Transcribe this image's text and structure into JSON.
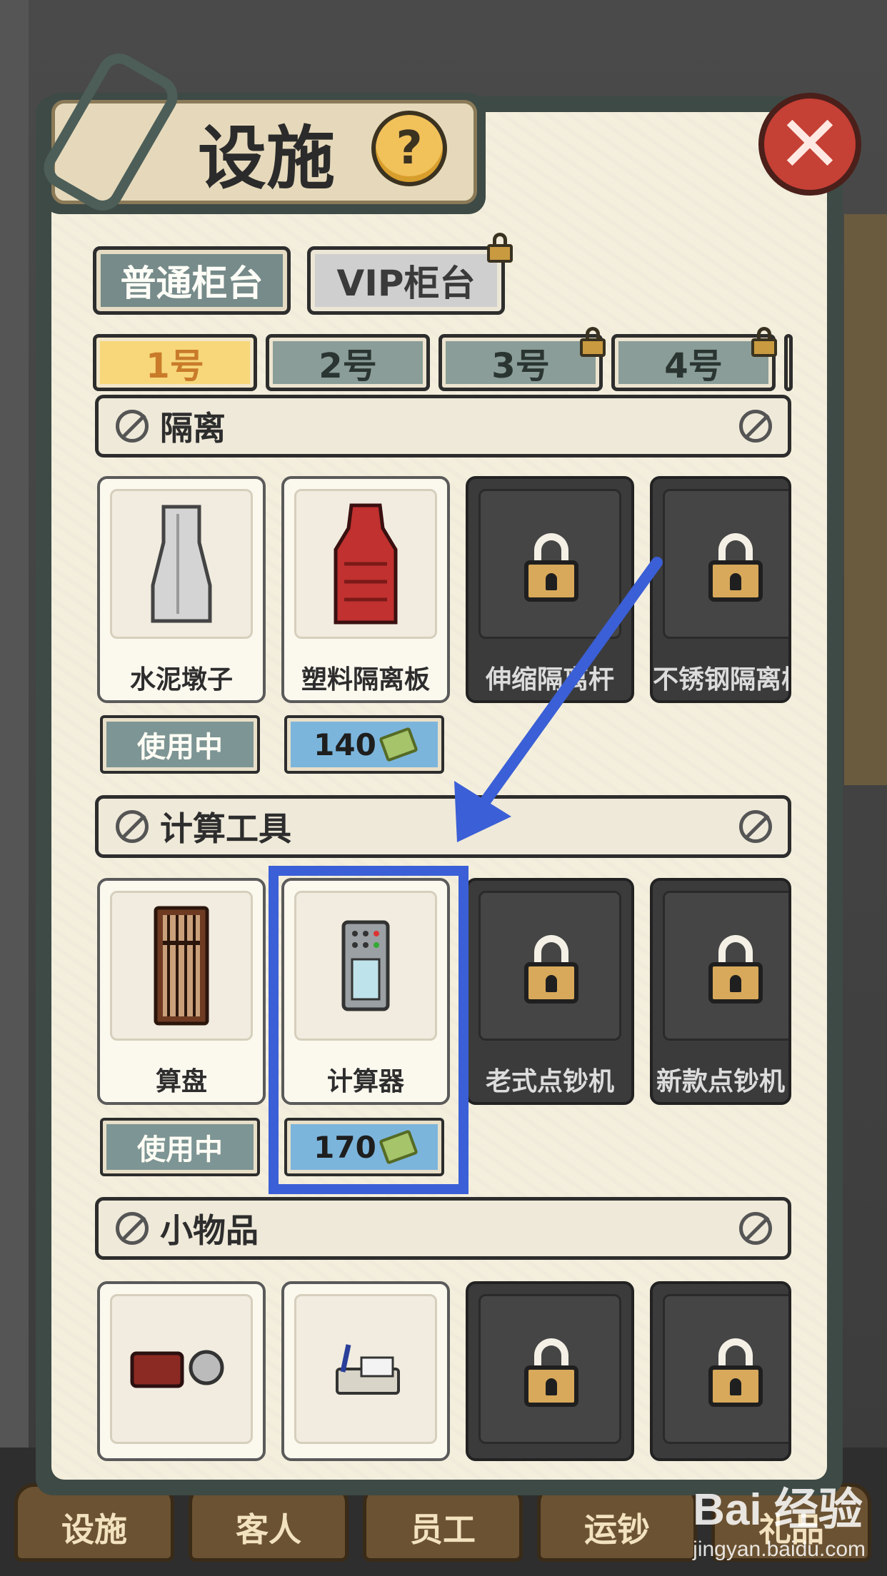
{
  "title": "设施",
  "help_label": "?",
  "close_label": "✕",
  "counter_types": [
    {
      "label": "普通柜台",
      "locked": false
    },
    {
      "label": "VIP柜台",
      "locked": true
    }
  ],
  "counter_numbers": [
    {
      "label": "1号",
      "active": true,
      "locked": false
    },
    {
      "label": "2号",
      "active": false,
      "locked": false
    },
    {
      "label": "3号",
      "active": false,
      "locked": true
    },
    {
      "label": "4号",
      "active": false,
      "locked": true
    }
  ],
  "sections": [
    {
      "title": "隔离",
      "items": [
        {
          "name": "水泥墩子",
          "locked": false,
          "status": "使用中"
        },
        {
          "name": "塑料隔离板",
          "locked": false,
          "price": "140"
        },
        {
          "name": "伸缩隔离杆",
          "locked": true
        },
        {
          "name": "不锈钢隔离栏",
          "locked": true
        }
      ]
    },
    {
      "title": "计算工具",
      "items": [
        {
          "name": "算盘",
          "locked": false,
          "status": "使用中"
        },
        {
          "name": "计算器",
          "locked": false,
          "price": "170"
        },
        {
          "name": "老式点钞机",
          "locked": true
        },
        {
          "name": "新款点钞机",
          "locked": true
        }
      ]
    },
    {
      "title": "小物品",
      "items": [
        {
          "name": "",
          "locked": false
        },
        {
          "name": "",
          "locked": false
        },
        {
          "name": "",
          "locked": true
        },
        {
          "name": "",
          "locked": true
        }
      ]
    }
  ],
  "bottom_nav": [
    "设施",
    "客人",
    "员工",
    "运钞",
    "礼品"
  ],
  "watermark": {
    "brand": "Bai 经验",
    "url": "jingyan.baidu.com"
  },
  "colors": {
    "highlight": "#3b5fd6",
    "arrow": "#3b5fd6",
    "close": "#c54035"
  }
}
